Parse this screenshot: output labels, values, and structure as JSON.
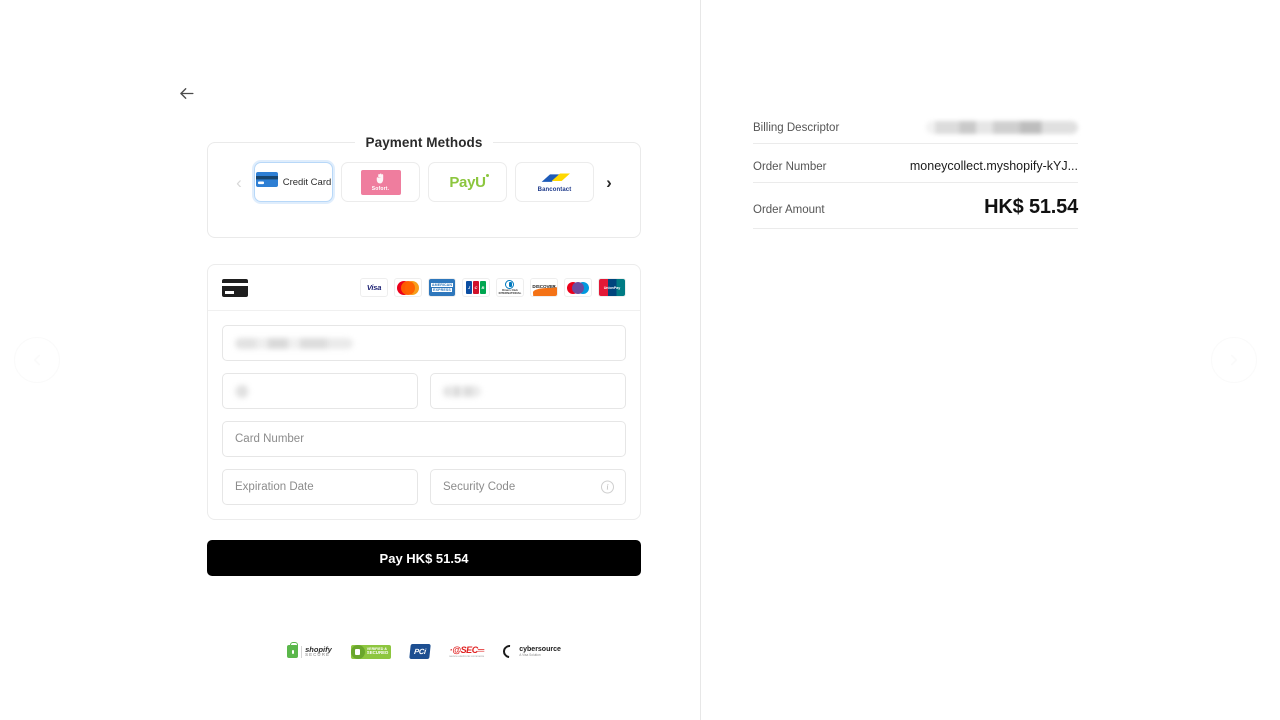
{
  "nav": {
    "back_icon": "arrow-left-icon",
    "prev_carousel_icon": "chevron-left-circle-icon",
    "next_carousel_icon": "chevron-right-circle-icon"
  },
  "payment_methods": {
    "title": "Payment Methods",
    "prev_label": "‹",
    "next_label": "›",
    "items": [
      {
        "id": "credit-card",
        "label": "Credit Card",
        "selected": true
      },
      {
        "id": "sofort",
        "label": "Sofort.",
        "selected": false
      },
      {
        "id": "payu",
        "label": "PayU",
        "selected": false
      },
      {
        "id": "bancontact",
        "label": "Bancontact",
        "selected": false
      }
    ]
  },
  "card_form": {
    "accepted_brands": [
      "Visa",
      "Mastercard",
      "American Express",
      "JCB",
      "Diners Club",
      "Discover",
      "Maestro",
      "UnionPay"
    ],
    "amex_line1": "AMERICAN",
    "amex_line2": "EXPRESS",
    "jcb_letters": [
      "J",
      "C",
      "B"
    ],
    "diners_text": "Diners Club",
    "diners_sub": "INTERNATIONAL",
    "discover_text": "DISCOVER",
    "unionpay_text": "UnionPay",
    "fields": [
      {
        "name": "email",
        "placeholder": "",
        "value": "",
        "redacted": true
      },
      {
        "name": "country",
        "placeholder": "",
        "value": "",
        "redacted": true
      },
      {
        "name": "postal-code",
        "placeholder": "",
        "value": "",
        "redacted": true
      },
      {
        "name": "card-number",
        "placeholder": "Card Number",
        "value": "",
        "redacted": false
      },
      {
        "name": "expiration-date",
        "placeholder": "Expiration Date",
        "value": "",
        "redacted": false
      },
      {
        "name": "security-code",
        "placeholder": "Security Code",
        "value": "",
        "redacted": false
      }
    ],
    "security_info_icon": "info-icon"
  },
  "pay_button": {
    "label": "Pay HK$ 51.54"
  },
  "badges": [
    {
      "id": "shopify-secure",
      "line1": "shopify",
      "line2": "SECURE"
    },
    {
      "id": "godaddy-secure",
      "line1": "VERIFIED &",
      "line2": "SECURED"
    },
    {
      "id": "pci",
      "text": "PCi"
    },
    {
      "id": "at-sec",
      "text": "·@SEC═",
      "sub": "secure electronic commerce"
    },
    {
      "id": "cybersource",
      "line1": "cybersource",
      "line2": "A Visa Solution"
    }
  ],
  "summary": {
    "rows": [
      {
        "label": "Billing Descriptor",
        "value": "",
        "redacted": true
      },
      {
        "label": "Order Number",
        "value": "moneycollect.myshopify-kYJ...",
        "redacted": false
      },
      {
        "label": "Order Amount",
        "value": "HK$ 51.54",
        "redacted": false,
        "emphasis": true
      }
    ]
  },
  "colors": {
    "accent_selected": "#b8d8f8",
    "pay_button_bg": "#000000",
    "sofort_pink": "#ef7d9e",
    "payu_green": "#8cc63e",
    "bancontact_blue": "#1e3a8a",
    "bancontact_yellow": "#ffd800"
  }
}
